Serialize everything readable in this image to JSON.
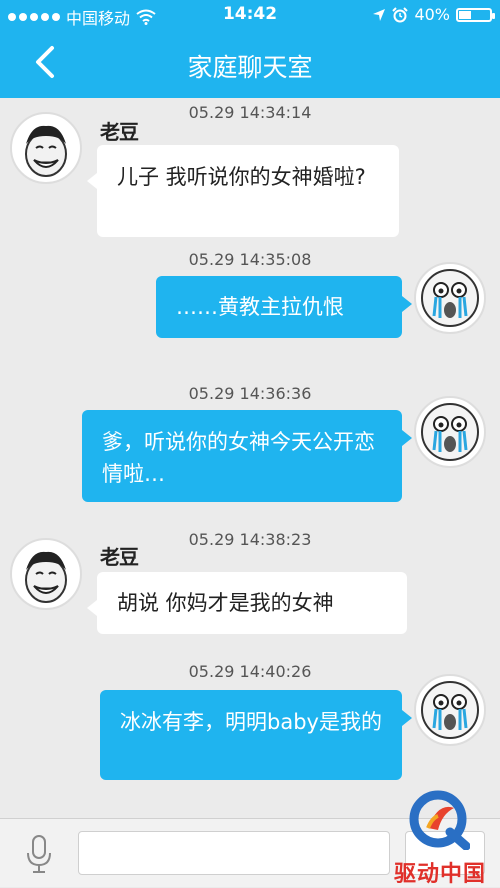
{
  "status": {
    "carrier": "中国移动",
    "time": "14:42",
    "battery": "40%",
    "battery_level": 0.4
  },
  "nav": {
    "title": "家庭聊天室"
  },
  "messages": [
    {
      "timestamp": "05.29 14:34:14",
      "sender": "老豆",
      "text": "儿子 我听说你的女神婚啦?",
      "direction": "incoming"
    },
    {
      "timestamp": "05.29 14:35:08",
      "text": "……黄教主拉仇恨",
      "direction": "outgoing"
    },
    {
      "timestamp": "05.29 14:36:36",
      "text": "爹，听说你的女神今天公开恋情啦…",
      "direction": "outgoing"
    },
    {
      "timestamp": "05.29 14:38:23",
      "sender": "老豆",
      "text": "胡说 你妈才是我的女神",
      "direction": "incoming"
    },
    {
      "timestamp": "05.29 14:40:26",
      "text": "冰冰有李，明明baby是我的",
      "direction": "outgoing"
    }
  ],
  "watermark": {
    "text": "驱动中国"
  },
  "colors": {
    "primary": "#1fb4ef",
    "background": "#ebebeb"
  }
}
